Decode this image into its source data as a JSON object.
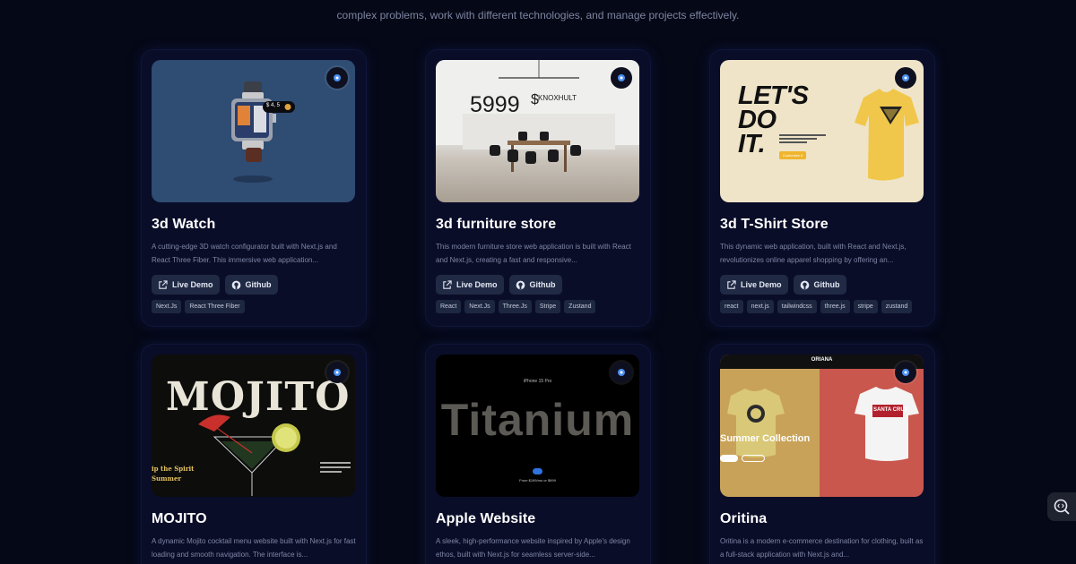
{
  "intro": {
    "line1": "projects and ... complex problems, work with different technologies, and manage projects effectively.",
    "line2": "complex problems, work with different technologies, and manage projects effectively."
  },
  "projects": [
    {
      "title": "3d Watch",
      "description": "A cutting-edge 3D watch configurator built with Next.js and React Three Fiber. This immersive web application...",
      "demo_label": "Live Demo",
      "github_label": "Github",
      "tags": [
        "Next.Js",
        "React Three Fiber"
      ],
      "overlay_text": "$ 4, 5"
    },
    {
      "title": "3d furniture store",
      "description": "This modern furniture store web application is built with React and Next.js, creating a fast and responsive...",
      "demo_label": "Live Demo",
      "github_label": "Github",
      "tags": [
        "React",
        "Next.Js",
        "Three.Js",
        "Stripe",
        "Zustand"
      ],
      "overlay_price": "5999",
      "overlay_currency": "$",
      "overlay_brand": "KNOXHULT"
    },
    {
      "title": "3d T-Shirt Store",
      "description": "This dynamic web application, built with React and Next.js, revolutionizes online apparel shopping by offering an...",
      "demo_label": "Live Demo",
      "github_label": "Github",
      "tags": [
        "react",
        "next.js",
        "tailwindcss",
        "three.js",
        "stripe",
        "zustand"
      ],
      "overlay_headline": [
        "LET'S",
        "DO",
        "IT."
      ],
      "overlay_button": "Customize it"
    },
    {
      "title": "MOJITO",
      "description": "A dynamic Mojito cocktail menu website built with Next.js for fast loading and smooth navigation. The interface is...",
      "overlay_wordmark": "MOJITO",
      "overlay_tagline": [
        "ip the Spirit",
        "Summer"
      ]
    },
    {
      "title": "Apple Website",
      "description": "A sleek, high-performance website inspired by Apple's design ethos, built with Next.js for seamless server-side...",
      "overlay_small": "iPhone 15 Pro",
      "overlay_big": "Titanium",
      "overlay_from": "From $199/mo or $999"
    },
    {
      "title": "Oritina",
      "description": "Oritina is a modern e-commerce destination for clothing, built as a full-stack application with Next.js and...",
      "overlay_brand": "ORIANA",
      "overlay_heading": "Summer Collection",
      "overlay_shirt_text": "SANTA CRUZ"
    }
  ],
  "colors": {
    "background": "#050816",
    "card": "#090d28",
    "button": "#202a44",
    "tag": "#1e2740",
    "muted_text": "#7f86a4"
  }
}
